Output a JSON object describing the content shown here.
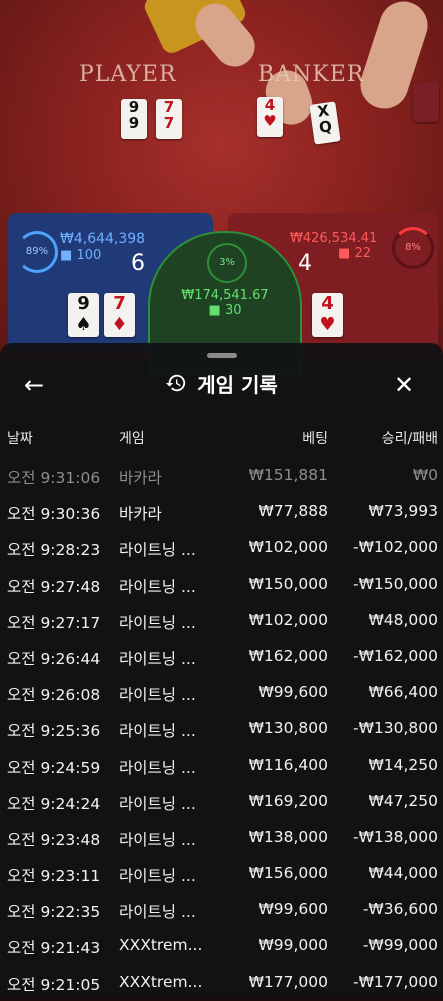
{
  "table": {
    "player_label": "PLAYER",
    "banker_label": "BANKER",
    "player_cards": [
      {
        "rank": "9",
        "suit": "♠",
        "red": false
      },
      {
        "rank": "7",
        "suit": "♦",
        "red": true
      }
    ],
    "banker_cards": [
      {
        "rank": "4",
        "suit": "♥",
        "red": true
      }
    ]
  },
  "stats": {
    "player": {
      "pct": "89%",
      "amount": "₩4,644,398",
      "players": "100",
      "score": "6"
    },
    "banker": {
      "pct": "8%",
      "amount": "₩426,534.41",
      "players": "22",
      "score": "4"
    },
    "tie": {
      "pct": "3%",
      "amount": "₩174,541.67",
      "players": "30"
    }
  },
  "sheet": {
    "title": "게임 기록",
    "headers": {
      "date": "날짜",
      "game": "게임",
      "bet": "베팅",
      "result": "승리/패배"
    },
    "rows": [
      {
        "time": "오전 9:31:06",
        "game": "바카라",
        "bet": "₩151,881",
        "result": "₩0"
      },
      {
        "time": "오전 9:30:36",
        "game": "바카라",
        "bet": "₩77,888",
        "result": "₩73,993"
      },
      {
        "time": "오전 9:28:23",
        "game": "라이트닝 ...",
        "bet": "₩102,000",
        "result": "-₩102,000"
      },
      {
        "time": "오전 9:27:48",
        "game": "라이트닝 ...",
        "bet": "₩150,000",
        "result": "-₩150,000"
      },
      {
        "time": "오전 9:27:17",
        "game": "라이트닝 ...",
        "bet": "₩102,000",
        "result": "₩48,000"
      },
      {
        "time": "오전 9:26:44",
        "game": "라이트닝 ...",
        "bet": "₩162,000",
        "result": "-₩162,000"
      },
      {
        "time": "오전 9:26:08",
        "game": "라이트닝 ...",
        "bet": "₩99,600",
        "result": "₩66,400"
      },
      {
        "time": "오전 9:25:36",
        "game": "라이트닝 ...",
        "bet": "₩130,800",
        "result": "-₩130,800"
      },
      {
        "time": "오전 9:24:59",
        "game": "라이트닝 ...",
        "bet": "₩116,400",
        "result": "₩14,250"
      },
      {
        "time": "오전 9:24:24",
        "game": "라이트닝 ...",
        "bet": "₩169,200",
        "result": "₩47,250"
      },
      {
        "time": "오전 9:23:48",
        "game": "라이트닝 ...",
        "bet": "₩138,000",
        "result": "-₩138,000"
      },
      {
        "time": "오전 9:23:11",
        "game": "라이트닝 ...",
        "bet": "₩156,000",
        "result": "₩44,000"
      },
      {
        "time": "오전 9:22:35",
        "game": "라이트닝 ...",
        "bet": "₩99,600",
        "result": "-₩36,600"
      },
      {
        "time": "오전 9:21:43",
        "game": "XXXtrem...",
        "bet": "₩99,000",
        "result": "-₩99,000"
      },
      {
        "time": "오전 9:21:05",
        "game": "XXXtrem...",
        "bet": "₩177,000",
        "result": "-₩177,000"
      }
    ]
  }
}
